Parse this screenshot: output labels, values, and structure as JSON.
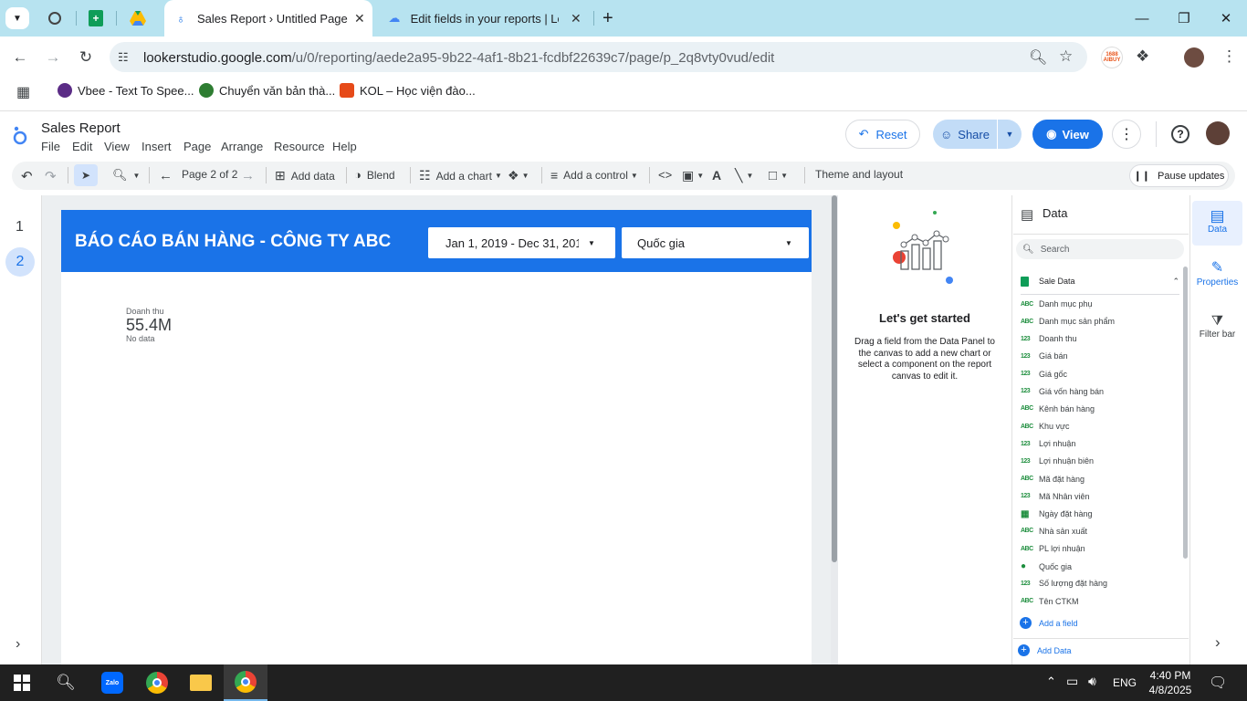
{
  "browser": {
    "tabs": [
      {
        "title": "Sales Report › Untitled Page"
      },
      {
        "title": "Edit fields in your reports  |  Loo"
      }
    ],
    "url_host": "lookerstudio.google.com",
    "url_path": "/u/0/reporting/aede2a95-9b22-4af1-8b21-fcdbf22639c7/page/p_2q8vty0vud/edit",
    "profile_badge": "1688 AIBUY",
    "bookmarks": [
      {
        "label": "Vbee - Text To Spee..."
      },
      {
        "label": "Chuyển văn bản thà..."
      },
      {
        "label": "KOL – Học viện đào..."
      }
    ]
  },
  "app": {
    "title": "Sales Report",
    "menus": [
      "File",
      "Edit",
      "View",
      "Insert",
      "Page",
      "Arrange",
      "Resource",
      "Help"
    ],
    "reset_label": "Reset",
    "share_label": "Share",
    "view_label": "View"
  },
  "toolbar": {
    "page_indicator": "Page 2 of 2",
    "add_data": "Add data",
    "blend": "Blend",
    "add_chart": "Add a chart",
    "add_control": "Add a control",
    "theme_layout": "Theme and layout",
    "pause_updates": "Pause updates"
  },
  "pages": [
    "1",
    "2"
  ],
  "report": {
    "banner_title": "BÁO CÁO BÁN HÀNG - CÔNG TY ABC",
    "date_range": "Jan 1, 2019 - Dec 31, 201",
    "country_filter": "Quốc gia",
    "scorecard": {
      "label": "Doanh thu",
      "value": "55.4M",
      "note": "No data"
    }
  },
  "get_started": {
    "heading": "Let's get started",
    "body": "Drag a field from the Data Panel to the canvas to add a new chart or select a component on the report canvas to edit it."
  },
  "data_panel": {
    "title": "Data",
    "search_placeholder": "Search",
    "source": "Sale Data",
    "fields": [
      {
        "type": "ABC",
        "name": "Danh mục phụ"
      },
      {
        "type": "ABC",
        "name": "Danh mục sản phẩm"
      },
      {
        "type": "123",
        "name": "Doanh thu"
      },
      {
        "type": "123",
        "name": "Giá bán"
      },
      {
        "type": "123",
        "name": "Giá gốc"
      },
      {
        "type": "123",
        "name": "Giá vốn hàng bán"
      },
      {
        "type": "ABC",
        "name": "Kênh bán hàng"
      },
      {
        "type": "ABC",
        "name": "Khu vực"
      },
      {
        "type": "123",
        "name": "Lợi nhuận"
      },
      {
        "type": "123",
        "name": "Lợi nhuận biên"
      },
      {
        "type": "ABC",
        "name": "Mã đặt hàng"
      },
      {
        "type": "123",
        "name": "Mã Nhân viên"
      },
      {
        "type": "date",
        "name": "Ngày đặt hàng"
      },
      {
        "type": "ABC",
        "name": "Nhà sản xuất"
      },
      {
        "type": "ABC",
        "name": "PL lợi nhuận"
      },
      {
        "type": "geo",
        "name": "Quốc gia"
      },
      {
        "type": "123",
        "name": "Số lượng đặt hàng"
      },
      {
        "type": "ABC",
        "name": "Tên CTKM"
      }
    ],
    "add_field": "Add a field",
    "add_data": "Add Data"
  },
  "right_rail": {
    "data": "Data",
    "properties": "Properties",
    "filter_bar": "Filter bar"
  },
  "taskbar": {
    "time": "4:40 PM",
    "date": "4/8/2025",
    "lang": "ENG"
  },
  "colors": {
    "accent": "#1a73e8",
    "tabstrip": "#b7e3f0",
    "taskbar": "#202020",
    "field_type": "#1e8e3e"
  }
}
